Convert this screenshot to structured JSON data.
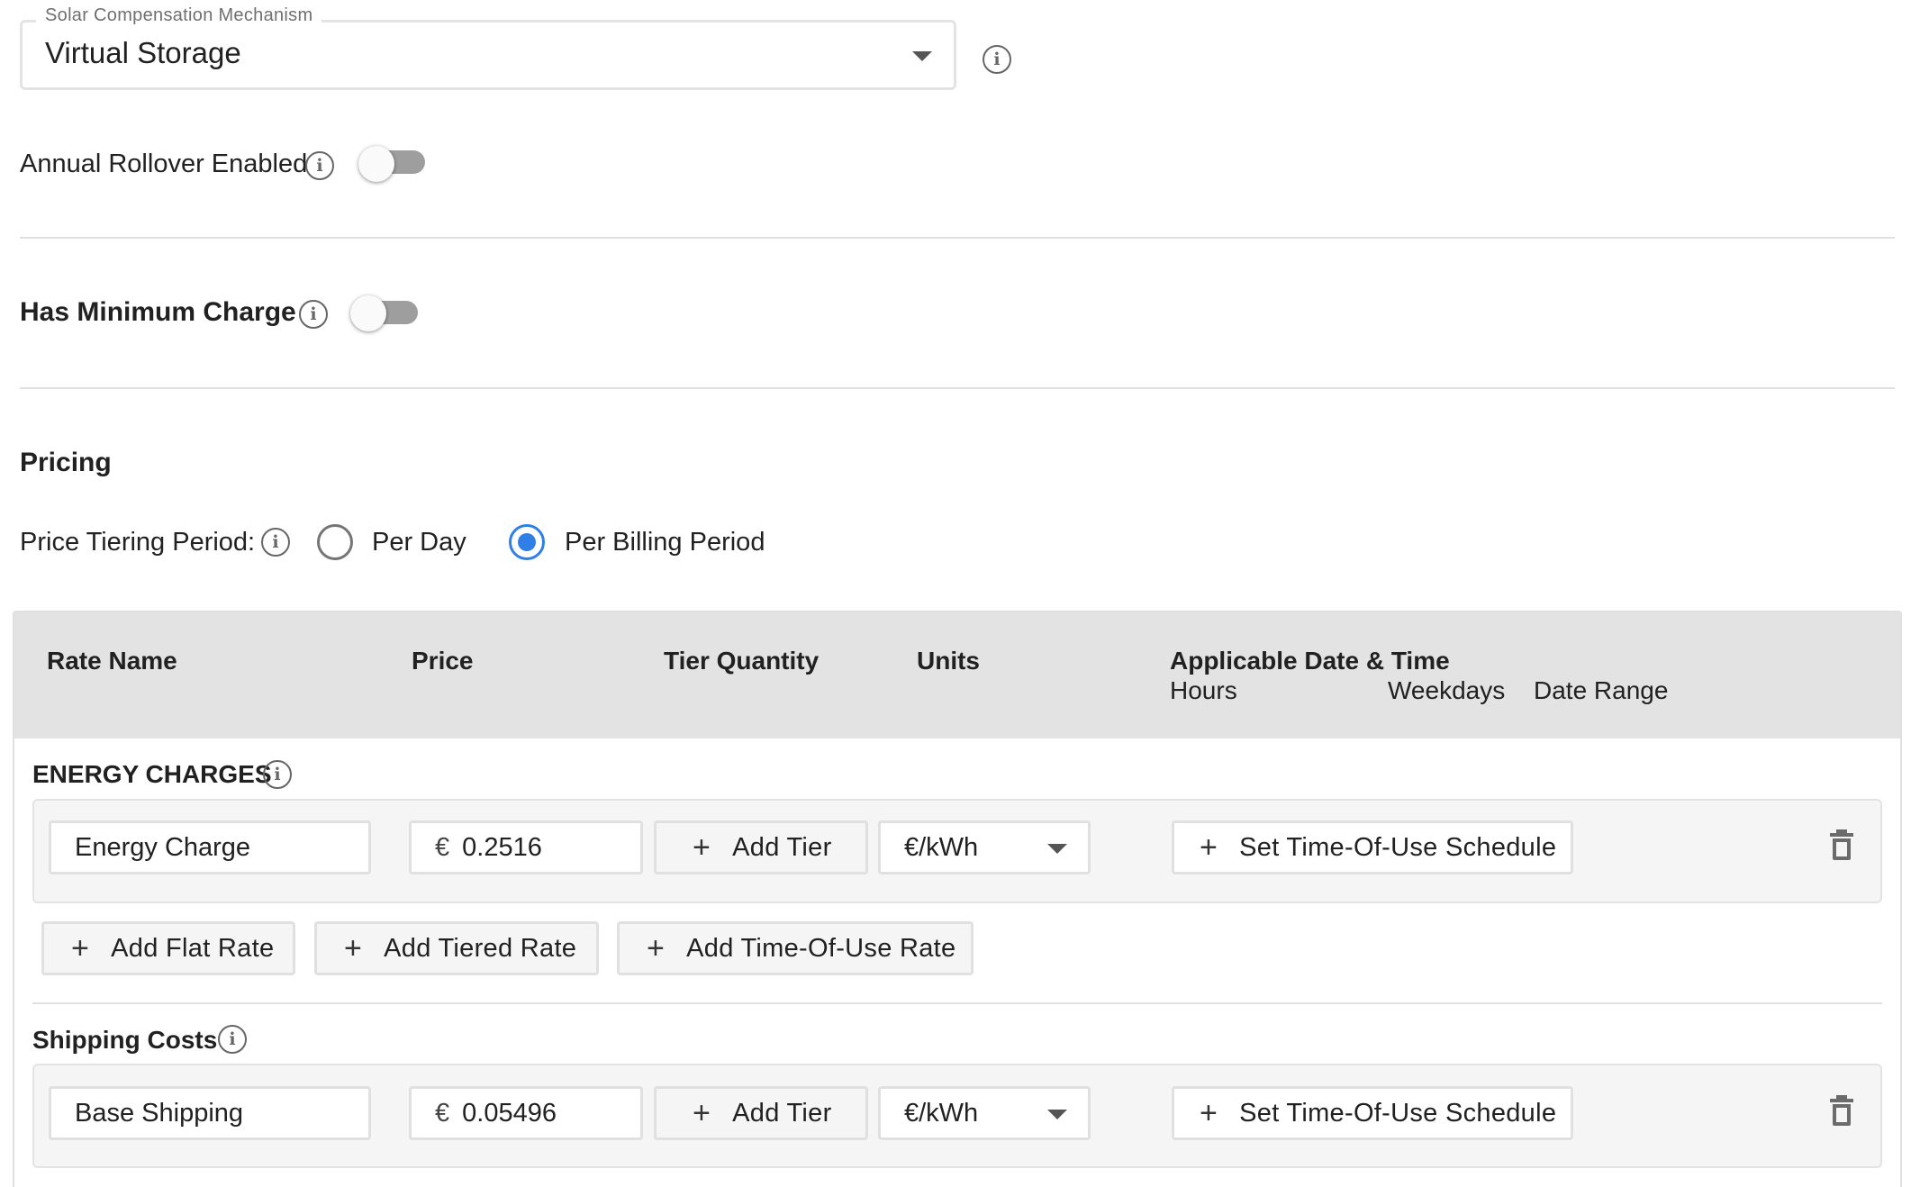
{
  "compensation": {
    "label": "Solar Compensation Mechanism",
    "value": "Virtual Storage"
  },
  "rollover": {
    "label": "Annual Rollover Enabled",
    "enabled": false
  },
  "minimum_charge": {
    "label": "Has Minimum Charge",
    "enabled": false
  },
  "pricing": {
    "heading": "Pricing",
    "tiering_label": "Price Tiering Period:",
    "options": [
      "Per Day",
      "Per Billing Period"
    ],
    "selected": "Per Billing Period"
  },
  "table": {
    "headers": {
      "rate_name": "Rate Name",
      "price": "Price",
      "tier_quantity": "Tier Quantity",
      "units": "Units",
      "applicable": "Applicable Date & Time",
      "hours": "Hours",
      "weekdays": "Weekdays",
      "date_range": "Date Range"
    },
    "sections": [
      {
        "title": "ENERGY CHARGES",
        "rows": [
          {
            "rate_name": "Energy Charge",
            "currency": "€",
            "price": "0.2516",
            "add_tier": "Add Tier",
            "units": "€/kWh",
            "schedule": "Set Time-Of-Use Schedule"
          }
        ],
        "actions": [
          "Add Flat Rate",
          "Add Tiered Rate",
          "Add Time-Of-Use Rate"
        ]
      },
      {
        "title": "Shipping Costs",
        "rows": [
          {
            "rate_name": "Base Shipping",
            "currency": "€",
            "price": "0.05496",
            "add_tier": "Add Tier",
            "units": "€/kWh",
            "schedule": "Set Time-Of-Use Schedule"
          }
        ]
      }
    ]
  },
  "colors": {
    "accent": "#2f7fe6",
    "header_bg": "#e3e3e3",
    "row_bg": "#f5f5f5"
  },
  "icons": {
    "info": "info-icon",
    "caret": "dropdown-caret-icon",
    "plus": "plus-icon",
    "delete": "trash-icon"
  }
}
